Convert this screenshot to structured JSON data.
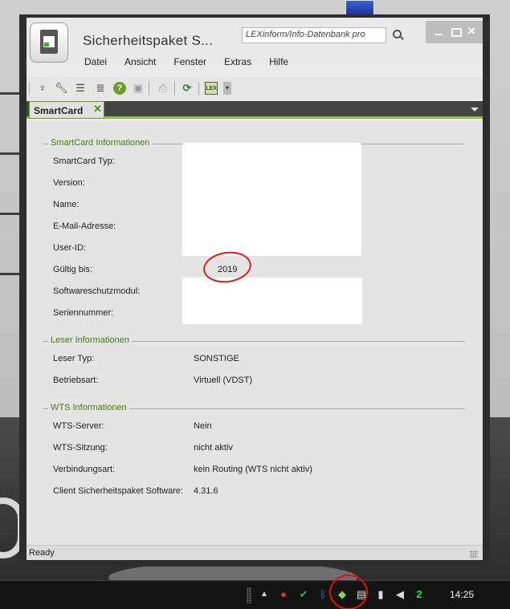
{
  "window": {
    "title": "Sicherheitspaket  S...",
    "search_placeholder": "LEXinform/Info-Datenbank pro",
    "minimize_label": "",
    "maximize_label": "",
    "close_label": "✕"
  },
  "menu": {
    "items": [
      "Datei",
      "Ansicht",
      "Fenster",
      "Extras",
      "Hilfe"
    ]
  },
  "toolbar": {
    "icons": [
      "tree-icon",
      "wrench-icon",
      "indent-list-icon",
      "numbered-list-icon",
      "help-icon",
      "save-icon",
      "print-icon",
      "refresh-icon",
      "lex-icon",
      "dropdown-icon"
    ]
  },
  "tabs": [
    {
      "label": "SmartCard",
      "close": "✕"
    }
  ],
  "sections": {
    "smartcard": {
      "title": "SmartCard Informationen",
      "fields": [
        {
          "label": "SmartCard Typ:",
          "value": ""
        },
        {
          "label": "Version:",
          "value": ""
        },
        {
          "label": "Name:",
          "value": ""
        },
        {
          "label": "E-Mail-Adresse:",
          "value": ""
        },
        {
          "label": "User-ID:",
          "value": ""
        },
        {
          "label": "Gültig bis:",
          "value": "2019"
        },
        {
          "label": "Softwareschutzmodul:",
          "value": ""
        },
        {
          "label": "Seriennummer:",
          "value": ""
        }
      ]
    },
    "reader": {
      "title": "Leser Informationen",
      "fields": [
        {
          "label": "Leser Typ:",
          "value": "SONSTIGE"
        },
        {
          "label": "Betriebsart:",
          "value": "Virtuell (VDST)"
        }
      ]
    },
    "wts": {
      "title": "WTS Informationen",
      "fields": [
        {
          "label": "WTS-Server:",
          "value": "Nein"
        },
        {
          "label": "WTS-Sitzung:",
          "value": "nicht aktiv"
        },
        {
          "label": "Verbindungsart:",
          "value": "kein Routing (WTS nicht aktiv)"
        },
        {
          "label": "Client Sicherheitspaket Software:",
          "value": "4.31.6"
        }
      ]
    }
  },
  "status": {
    "text": "Ready"
  },
  "taskbar": {
    "clock": "14:25",
    "tray_icons": [
      "show-hidden-icons-icon",
      "traffic-light-icon",
      "green-check-icon",
      "bluetooth-icon",
      "smartcard-reader-icon",
      "network-icon",
      "device-icon",
      "volume-icon",
      "green-digit-icon"
    ]
  },
  "colors": {
    "accent_green": "#8fbf3f",
    "legend_green": "#4a7a18",
    "annotation_red": "#d02020"
  }
}
